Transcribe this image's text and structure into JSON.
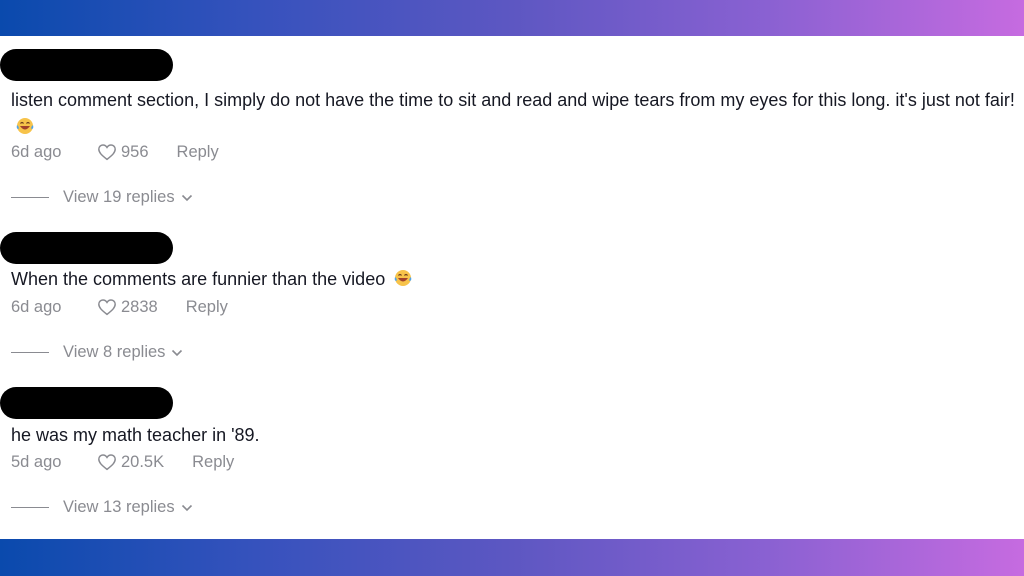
{
  "colors": {
    "band_start": "#0a4aad",
    "band_end": "#c66be0",
    "text": "#161823",
    "muted": "#8a8b91"
  },
  "comments": [
    {
      "username": "[redacted]",
      "text": "listen comment section, I simply do not have the time to sit and read and wipe tears from my eyes for this long. it's just not fair!",
      "emoji": "face-with-tears-of-joy",
      "time": "6d ago",
      "likes": "956",
      "reply_label": "Reply",
      "view_replies": "View 19 replies"
    },
    {
      "username": "[redacted]",
      "text": "When the comments are funnier than the video",
      "emoji": "face-with-tears-of-joy",
      "time": "6d ago",
      "likes": "2838",
      "reply_label": "Reply",
      "view_replies": "View 8 replies"
    },
    {
      "username": "[redacted]",
      "text": "he was my math teacher in '89.",
      "emoji": null,
      "time": "5d ago",
      "likes": "20.5K",
      "reply_label": "Reply",
      "view_replies": "View 13 replies"
    }
  ]
}
